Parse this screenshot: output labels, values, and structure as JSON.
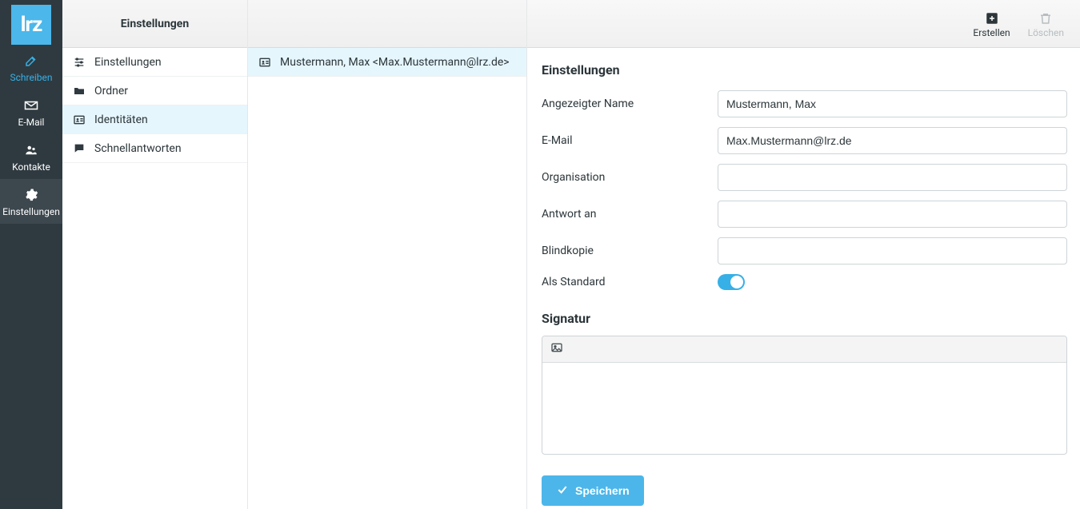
{
  "logo_text": "lrz",
  "nav": {
    "compose": "Schreiben",
    "mail": "E-Mail",
    "contacts": "Kontakte",
    "settings": "Einstellungen"
  },
  "settings_column": {
    "header": "Einstellungen",
    "items": {
      "settings": "Einstellungen",
      "folders": "Ordner",
      "identities": "Identitäten",
      "responses": "Schnellantworten"
    }
  },
  "identities_column": {
    "selected": "Mustermann, Max <Max.Mustermann@lrz.de>"
  },
  "toolbar": {
    "create": "Erstellen",
    "delete": "Löschen"
  },
  "form": {
    "section_title": "Einstellungen",
    "display_name_label": "Angezeigter Name",
    "display_name_value": "Mustermann, Max",
    "email_label": "E-Mail",
    "email_value": "Max.Mustermann@lrz.de",
    "organization_label": "Organisation",
    "organization_value": "",
    "replyto_label": "Antwort an",
    "replyto_value": "",
    "bcc_label": "Blindkopie",
    "bcc_value": "",
    "default_label": "Als Standard",
    "default_on": true,
    "signature_title": "Signatur",
    "signature_value": "",
    "save_label": "Speichern"
  }
}
